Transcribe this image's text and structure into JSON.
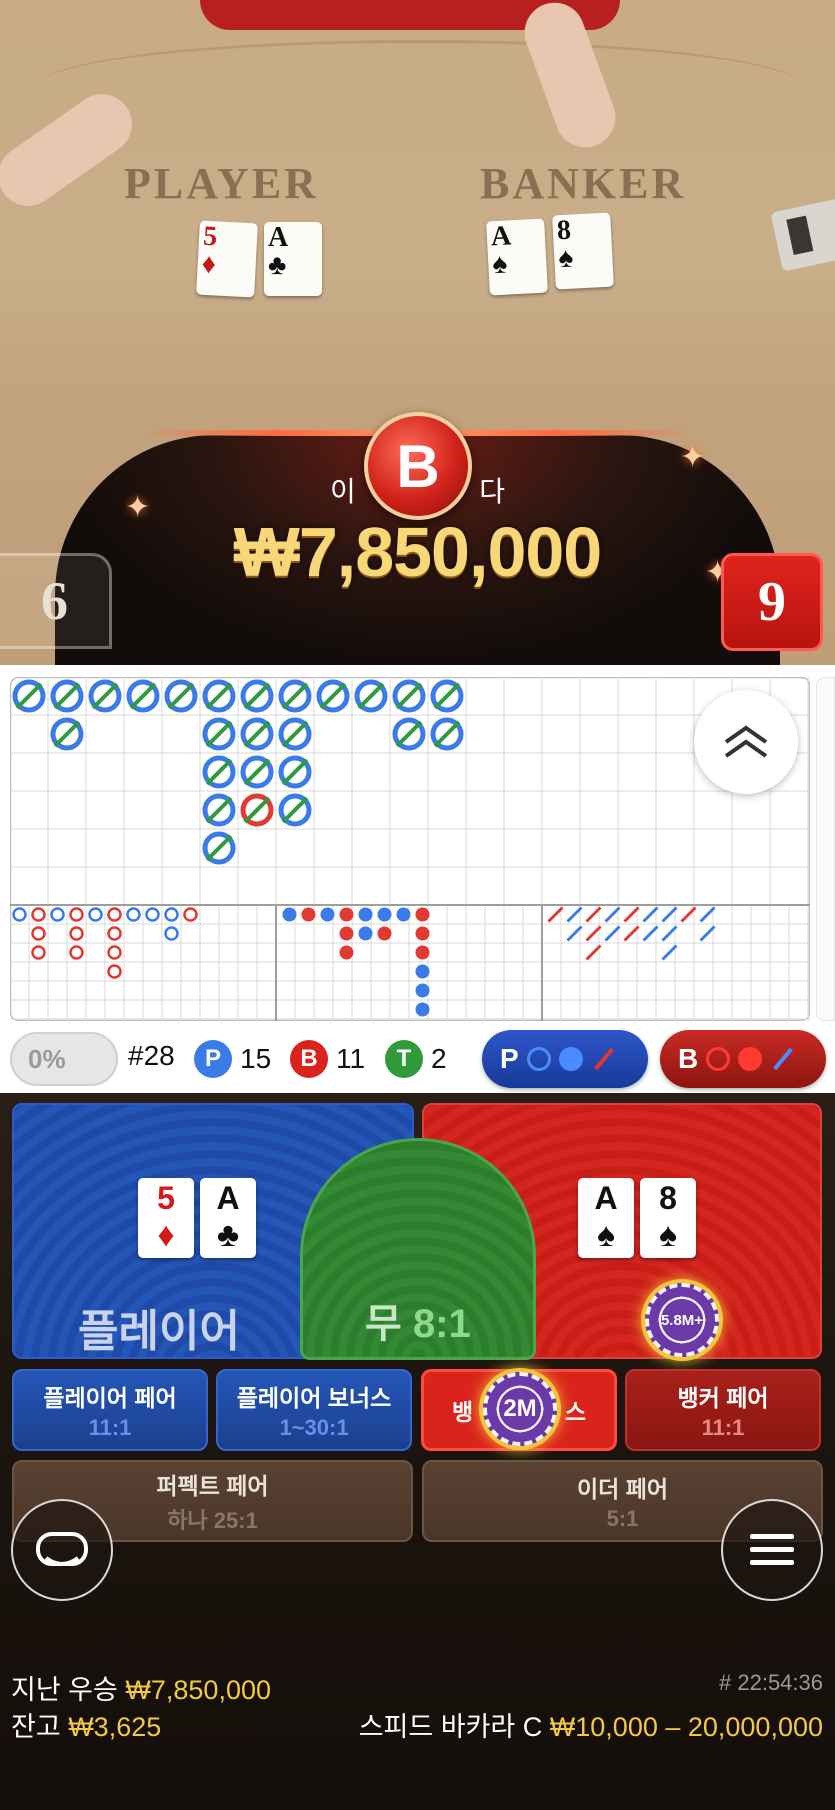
{
  "video": {
    "player_zone": "PLAYER",
    "banker_zone": "BANKER",
    "player_cards": [
      {
        "rank": "5",
        "suit": "♦",
        "color": "red"
      },
      {
        "rank": "A",
        "suit": "♣",
        "color": "black"
      }
    ],
    "banker_cards": [
      {
        "rank": "A",
        "suit": "♠",
        "color": "black"
      },
      {
        "rank": "8",
        "suit": "♠",
        "color": "black"
      }
    ],
    "win_badge": "B",
    "win_text_left": "이",
    "win_text_right": "다",
    "win_amount": "₩7,850,000",
    "player_score": "6",
    "banker_score": "9"
  },
  "stats": {
    "percent": "0%",
    "round": "#28",
    "player_label": "P",
    "player_count": "15",
    "banker_label": "B",
    "banker_count": "11",
    "tie_label": "T",
    "tie_count": "2",
    "predict_player": "P",
    "predict_banker": "B"
  },
  "bets": {
    "player": {
      "label": "플레이어",
      "cards": [
        {
          "rank": "5",
          "suit": "♦",
          "color": "red"
        },
        {
          "rank": "A",
          "suit": "♣",
          "color": "black"
        }
      ]
    },
    "tie": {
      "label": "무",
      "odds": "8:1"
    },
    "banker": {
      "cards": [
        {
          "rank": "A",
          "suit": "♠",
          "color": "black"
        },
        {
          "rank": "8",
          "suit": "♠",
          "color": "black"
        }
      ],
      "chip": "5.8M+"
    },
    "player_pair": {
      "label": "플레이어 페어",
      "odds": "11:1"
    },
    "player_bonus": {
      "label": "플레이어 보너스",
      "odds": "1~30:1"
    },
    "banker_bonus": {
      "label_left": "뱅",
      "label_right": "스",
      "chip": "2M"
    },
    "banker_pair": {
      "label": "뱅커 페어",
      "odds": "11:1"
    },
    "perfect_pair": {
      "label": "퍼펙트 페어",
      "odds": "하나 25:1"
    },
    "either_pair": {
      "label": "이더 페어",
      "odds": "5:1"
    }
  },
  "footer": {
    "last_win_label": "지난 우승",
    "last_win_value": "₩7,850,000",
    "balance_label": "잔고",
    "balance_value": "₩3,625",
    "game_id": "# 22:54:36",
    "table_name": "스피드 바카라 C",
    "limits": "₩10,000 – 20,000,000"
  },
  "colors": {
    "player_blue": "#3b7be8",
    "banker_red": "#d9231c",
    "tie_green": "#2f9a3a",
    "gold": "#f2c943"
  }
}
